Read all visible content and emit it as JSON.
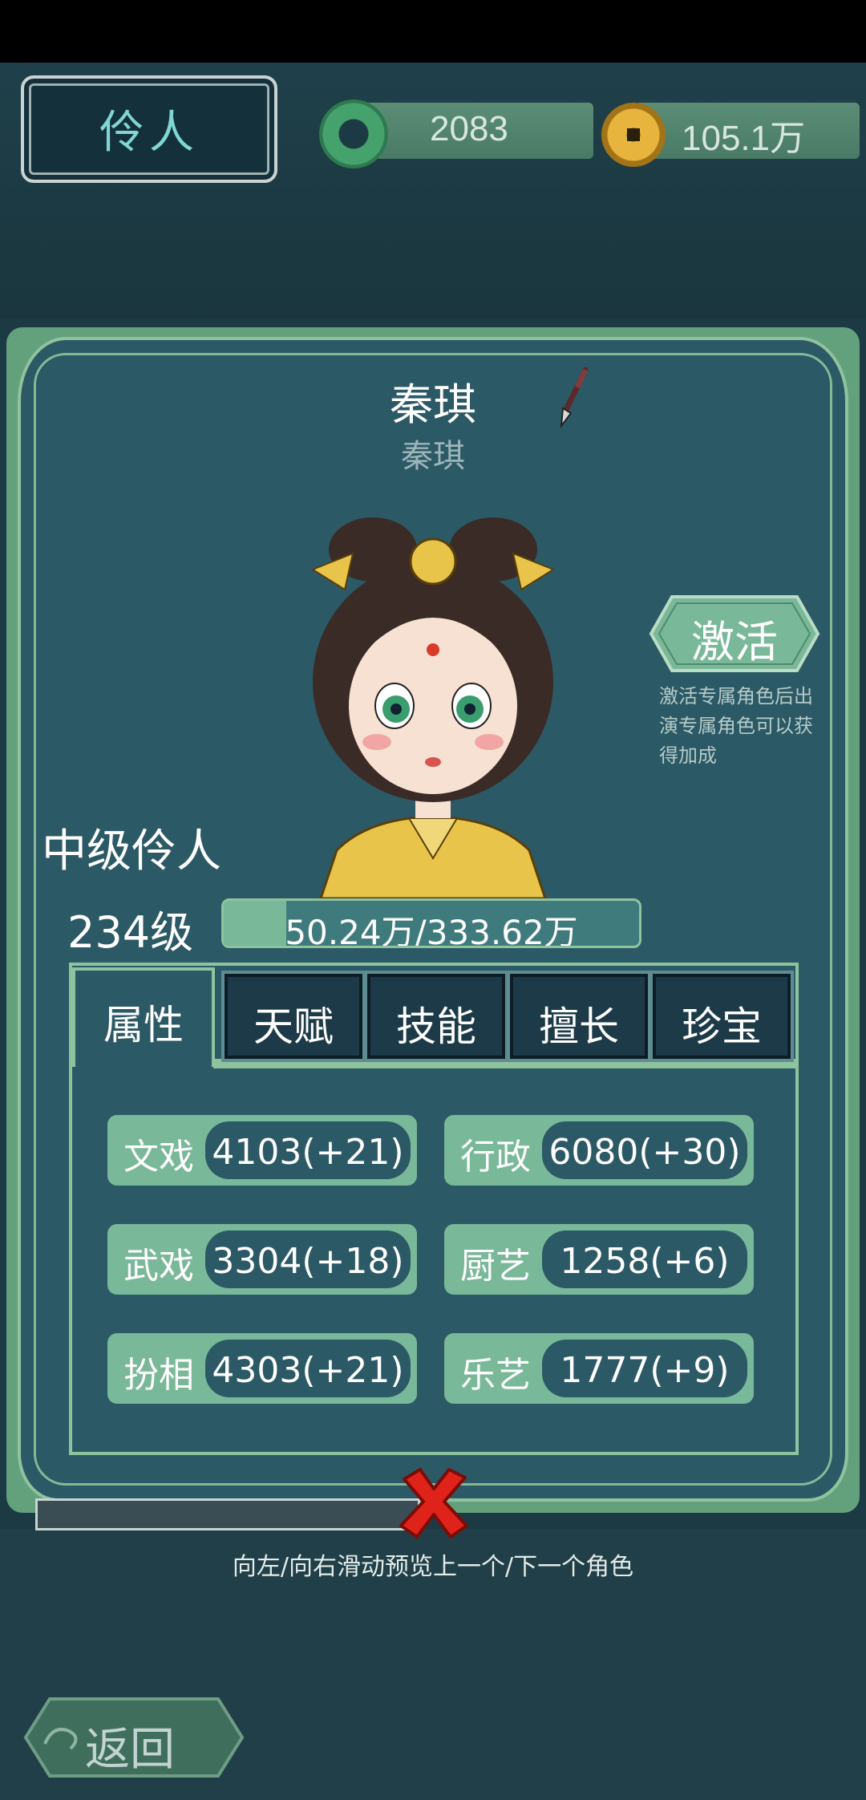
{
  "header": {
    "title": "伶人"
  },
  "currency": {
    "jade": "2083",
    "coins": "105.1万"
  },
  "character": {
    "name": "秦琪",
    "subtitle": "秦琪",
    "rank": "中级伶人",
    "level": "234级",
    "exp_text": "50.24万/333.62万",
    "exp_fraction": 0.15
  },
  "activate": {
    "button_label": "激活",
    "note": "激活专属角色后出演专属角色可以获得加成"
  },
  "tabs": [
    {
      "label": "属性",
      "active": true
    },
    {
      "label": "天赋",
      "active": false
    },
    {
      "label": "技能",
      "active": false
    },
    {
      "label": "擅长",
      "active": false
    },
    {
      "label": "珍宝",
      "active": false
    }
  ],
  "stats": [
    {
      "label": "文戏",
      "value": "4103(+21)"
    },
    {
      "label": "行政",
      "value": "6080(+30)"
    },
    {
      "label": "武戏",
      "value": "3304(+18)"
    },
    {
      "label": "厨艺",
      "value": "1258(+6)"
    },
    {
      "label": "扮相",
      "value": "4303(+21)"
    },
    {
      "label": "乐艺",
      "value": "1777(+9)"
    }
  ],
  "footer": {
    "swipe_hint": "向左/向右滑动预览上一个/下一个角色",
    "back_label": "返回"
  },
  "colors": {
    "panel": "#2c5966",
    "accent_green": "#79b898",
    "close_red": "#e0231a"
  }
}
